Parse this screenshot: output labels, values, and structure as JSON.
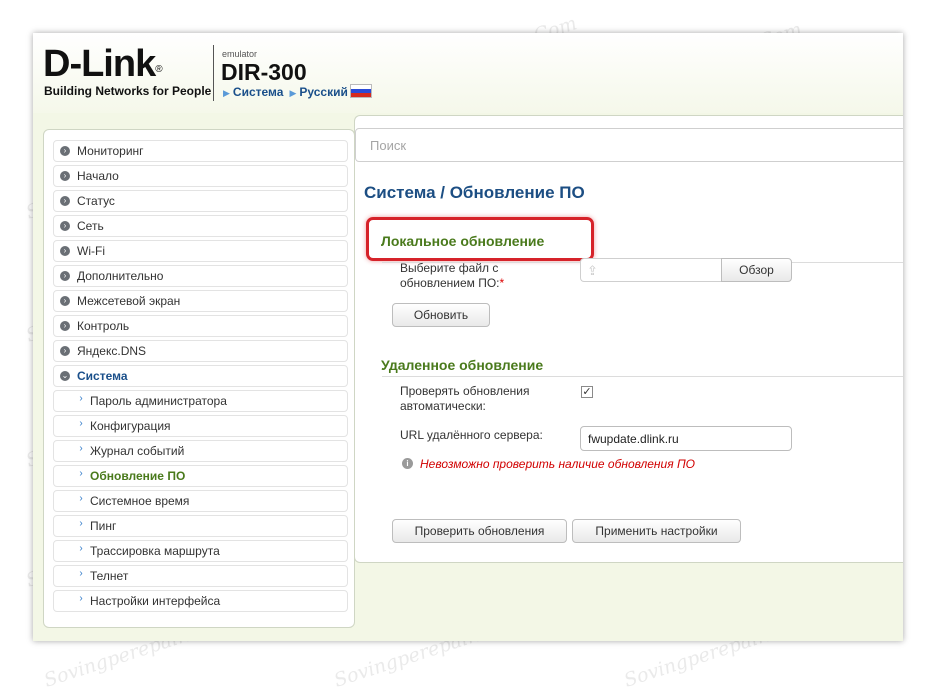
{
  "header": {
    "logo_text": "D-Link",
    "logo_reg": "®",
    "tagline": "Building Networks for People",
    "emulator": "emulator",
    "model": "DIR-300",
    "breadcrumb": [
      "Система",
      "Русский"
    ]
  },
  "search": {
    "placeholder": "Поиск"
  },
  "sidebar": {
    "items": [
      {
        "label": "Мониторинг"
      },
      {
        "label": "Начало"
      },
      {
        "label": "Статус"
      },
      {
        "label": "Сеть"
      },
      {
        "label": "Wi-Fi"
      },
      {
        "label": "Дополнительно"
      },
      {
        "label": "Межсетевой экран"
      },
      {
        "label": "Контроль"
      },
      {
        "label": "Яндекс.DNS"
      },
      {
        "label": "Система"
      }
    ],
    "subitems": [
      {
        "label": "Пароль администратора"
      },
      {
        "label": "Конфигурация"
      },
      {
        "label": "Журнал событий"
      },
      {
        "label": "Обновление ПО"
      },
      {
        "label": "Системное время"
      },
      {
        "label": "Пинг"
      },
      {
        "label": "Трассировка маршрута"
      },
      {
        "label": "Телнет"
      },
      {
        "label": "Настройки интерфейса"
      }
    ]
  },
  "page": {
    "title": "Система /  Обновление ПО",
    "local": {
      "title": "Локальное обновление",
      "file_label_1": "Выберите файл с",
      "file_label_2": "обновлением ПО:",
      "required_mark": "*",
      "browse_button": "Обзор",
      "update_button": "Обновить"
    },
    "remote": {
      "title": "Удаленное обновление",
      "auto_label_1": "Проверять обновления",
      "auto_label_2": "автоматически:",
      "auto_checked": true,
      "check_mark": "✓",
      "url_label": "URL удалённого сервера:",
      "url_value": "fwupdate.dlink.ru",
      "error": "Невозможно проверить наличие обновления ПО",
      "check_button": "Проверить обновления",
      "apply_button": "Применить настройки"
    }
  },
  "watermark": "Sovingperepair.Com"
}
